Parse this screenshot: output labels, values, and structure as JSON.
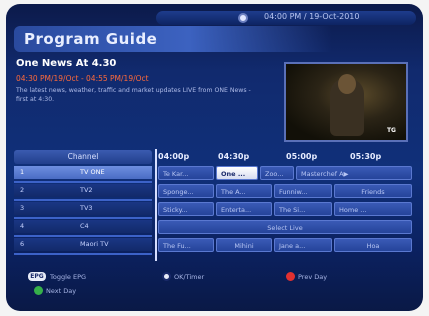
{
  "status": {
    "datetime": "04:00 PM / 19-Oct-2010"
  },
  "guide": {
    "title": "Program Guide"
  },
  "program": {
    "name": "One News At 4.30",
    "time": "04:30 PM/19/Oct - 04:55 PM/19/Oct",
    "description": "The latest news, weather, traffic and market updates LIVE from ONE News - first at 4:30."
  },
  "preview": {
    "logo": "TG"
  },
  "channels": {
    "header": "Channel",
    "items": [
      {
        "num": "1",
        "name": "TV ONE"
      },
      {
        "num": "2",
        "name": "TV2"
      },
      {
        "num": "3",
        "name": "TV3"
      },
      {
        "num": "4",
        "name": "C4"
      },
      {
        "num": "6",
        "name": "Maori TV"
      }
    ]
  },
  "times": [
    "04:00p",
    "04:30p",
    "05:00p",
    "05:30p"
  ],
  "grid": {
    "r0": [
      "Te Kar...",
      "One ...",
      "Zoo...",
      "Masterchef A▶"
    ],
    "r1": [
      "Sponge...",
      "The A...",
      "Funniw...",
      "Friends"
    ],
    "r2": [
      "Sticky...",
      "Enterta...",
      "The Si...",
      "Home ..."
    ],
    "r3": [
      "Select Live"
    ],
    "r4": [
      "The Fu...",
      "Mihini",
      "Jane a...",
      "Hoa"
    ]
  },
  "footer": {
    "epg": "EPG",
    "toggle": "Toggle EPG",
    "timer": "OK/Timer",
    "prev_day": "Prev Day",
    "next_day": "Next Day"
  },
  "colors": {
    "red": "#e23030",
    "green": "#36b04a",
    "accent": "#ff6a3a"
  }
}
